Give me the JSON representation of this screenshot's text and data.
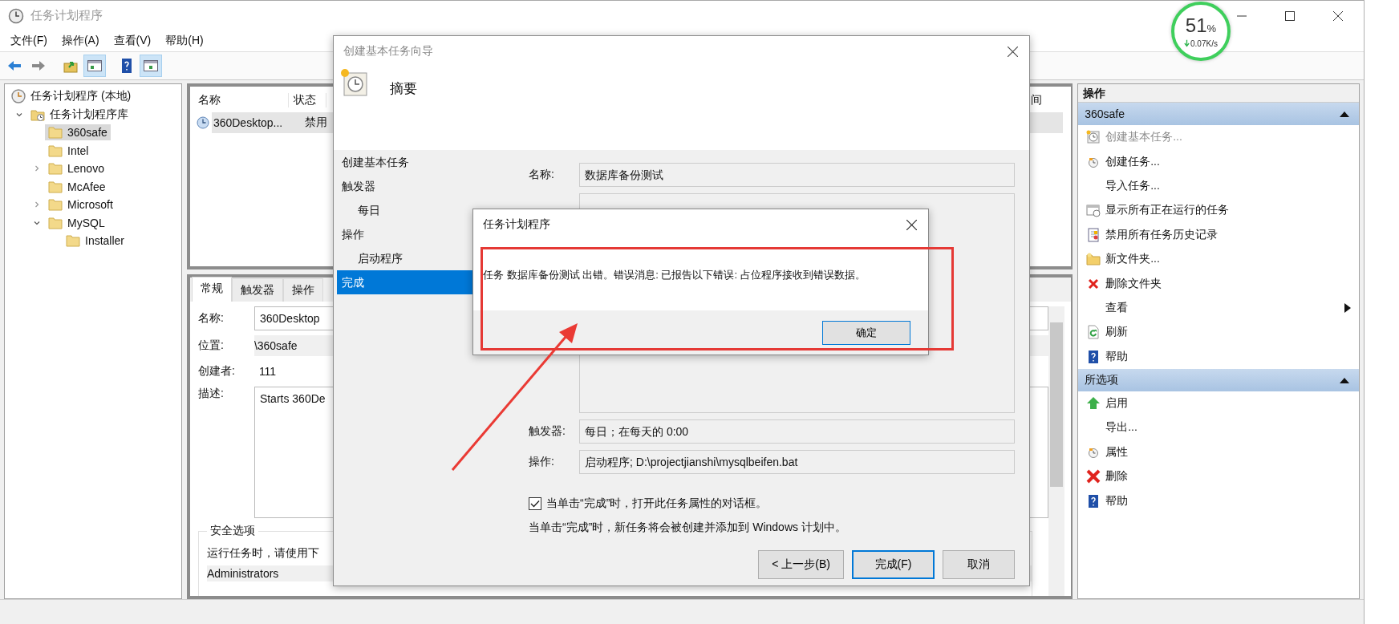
{
  "window": {
    "title": "任务计划程序"
  },
  "menu": [
    "文件(F)",
    "操作(A)",
    "查看(V)",
    "帮助(H)"
  ],
  "toolbar": [
    {
      "pressed": false
    },
    {
      "pressed": false
    },
    {
      "pressed": false
    },
    {
      "pressed": true
    },
    {
      "pressed": false
    },
    {
      "pressed": true
    }
  ],
  "speed_widget": {
    "percent": "51",
    "unit": "%",
    "rate": "0.07K/s"
  },
  "tree": {
    "label": "任务计划程序 (本地)",
    "selected": false,
    "children": [
      {
        "label": "任务计划程序库",
        "expanded": true,
        "selected": false,
        "children": [
          {
            "label": "360safe",
            "selected": true
          },
          {
            "label": "Intel",
            "selected": false
          },
          {
            "label": "Lenovo",
            "expanded": false,
            "selected": false
          },
          {
            "label": "McAfee",
            "selected": false
          },
          {
            "label": "Microsoft",
            "expanded": false,
            "selected": false
          },
          {
            "label": "MySQL",
            "expanded": true,
            "selected": false,
            "children": [
              {
                "label": "Installer",
                "selected": false
              }
            ]
          }
        ]
      }
    ]
  },
  "task_list": {
    "columns": [
      "名称",
      "状态",
      "间"
    ],
    "rows": [
      {
        "cells": [
          "360Desktop...",
          "禁用"
        ],
        "selected": true
      }
    ]
  },
  "task_details": {
    "tabs": [
      {
        "label": "常规",
        "selected": true
      },
      {
        "label": "触发器",
        "selected": false
      },
      {
        "label": "操作",
        "selected": false
      }
    ],
    "fields": [
      {
        "label": "名称:",
        "value": "360Desktop",
        "kind": "input"
      },
      {
        "label": "位置:",
        "value": "\\360safe",
        "kind": "readonly"
      },
      {
        "label": "创建者:",
        "value": "111",
        "kind": "text"
      },
      {
        "label": "描述:",
        "value": "Starts 360De",
        "kind": "textarea"
      }
    ],
    "security": {
      "title": "安全选项",
      "text": "运行任务时，请使用下",
      "account": "Administrators"
    }
  },
  "wizard": {
    "title": "创建基本任务向导",
    "heading": "摘要",
    "steps": [
      {
        "label": "创建基本任务",
        "selected": false
      },
      {
        "label": "触发器",
        "selected": false,
        "children": [
          {
            "label": "每日",
            "selected": false
          }
        ]
      },
      {
        "label": "操作",
        "selected": false,
        "children": [
          {
            "label": "启动程序",
            "selected": false
          }
        ]
      },
      {
        "label": "完成",
        "selected": true
      }
    ],
    "name": {
      "label": "名称:",
      "value": "数据库备份测试"
    },
    "trigger": {
      "label": "触发器:",
      "value": "每日；在每天的 0:00"
    },
    "action": {
      "label": "操作:",
      "value": "启动程序; D:\\projectjianshi\\mysqlbeifen.bat"
    },
    "open_properties": {
      "label": "当单击“完成”时，打开此任务属性的对话框。",
      "checked": true
    },
    "note": "当单击“完成”时，新任务将会被创建并添加到 Windows 计划中。",
    "buttons": [
      {
        "label": "< 上一步(B)",
        "default": false
      },
      {
        "label": "完成(F)",
        "default": true
      },
      {
        "label": "取消",
        "default": false
      }
    ]
  },
  "message_box": {
    "title": "任务计划程序",
    "message": "任务 数据库备份测试 出错。错误消息: 已报告以下错误: 占位程序接收到错误数据。",
    "button": "确定"
  },
  "actions_pane": {
    "title": "操作",
    "sections": [
      {
        "title": "360safe",
        "expanded": true,
        "items": [
          {
            "label": "创建基本任务...",
            "disabled": true,
            "submenu": false
          },
          {
            "label": "创建任务...",
            "disabled": false,
            "submenu": false
          },
          {
            "label": "导入任务...",
            "disabled": false,
            "submenu": false
          },
          {
            "label": "显示所有正在运行的任务",
            "disabled": false,
            "submenu": false
          },
          {
            "label": "禁用所有任务历史记录",
            "disabled": false,
            "submenu": false
          },
          {
            "label": "新文件夹...",
            "disabled": false,
            "submenu": false
          },
          {
            "label": "删除文件夹",
            "disabled": false,
            "submenu": false
          },
          {
            "label": "查看",
            "disabled": false,
            "submenu": true
          },
          {
            "label": "刷新",
            "disabled": false,
            "submenu": false
          },
          {
            "label": "帮助",
            "disabled": false,
            "submenu": false
          }
        ]
      },
      {
        "title": "所选项",
        "expanded": true,
        "items": [
          {
            "label": "启用",
            "disabled": false,
            "submenu": false
          },
          {
            "label": "导出...",
            "disabled": false,
            "submenu": false
          },
          {
            "label": "属性",
            "disabled": false,
            "submenu": false
          },
          {
            "label": "删除",
            "disabled": false,
            "submenu": false
          },
          {
            "label": "帮助",
            "disabled": false,
            "submenu": false
          }
        ]
      }
    ]
  }
}
